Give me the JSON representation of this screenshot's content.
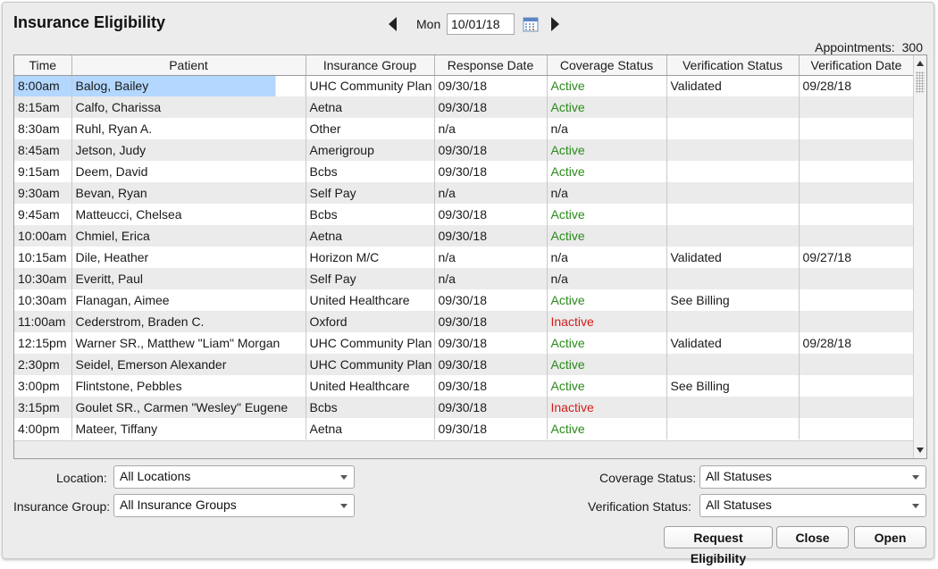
{
  "title": "Insurance Eligibility",
  "date_nav": {
    "day": "Mon",
    "date": "10/01/18"
  },
  "appointments": {
    "label": "Appointments:",
    "count": "300"
  },
  "columns": [
    "Time",
    "Patient",
    "Insurance Group",
    "Response Date",
    "Coverage Status",
    "Verification Status",
    "Verification Date"
  ],
  "rows": [
    {
      "time": "8:00am",
      "patient": "Balog, Bailey",
      "group": "UHC Community Plan",
      "response": "09/30/18",
      "coverage": "Active",
      "verification": "Validated",
      "vdate": "09/28/18"
    },
    {
      "time": "8:15am",
      "patient": "Calfo, Charissa",
      "group": "Aetna",
      "response": "09/30/18",
      "coverage": "Active",
      "verification": "",
      "vdate": ""
    },
    {
      "time": "8:30am",
      "patient": "Ruhl, Ryan A.",
      "group": "Other",
      "response": "n/a",
      "coverage": "n/a",
      "verification": "",
      "vdate": ""
    },
    {
      "time": "8:45am",
      "patient": "Jetson, Judy",
      "group": "Amerigroup",
      "response": "09/30/18",
      "coverage": "Active",
      "verification": "",
      "vdate": ""
    },
    {
      "time": "9:15am",
      "patient": "Deem, David",
      "group": "Bcbs",
      "response": "09/30/18",
      "coverage": "Active",
      "verification": "",
      "vdate": ""
    },
    {
      "time": "9:30am",
      "patient": "Bevan, Ryan",
      "group": "Self Pay",
      "response": "n/a",
      "coverage": "n/a",
      "verification": "",
      "vdate": ""
    },
    {
      "time": "9:45am",
      "patient": "Matteucci, Chelsea",
      "group": "Bcbs",
      "response": "09/30/18",
      "coverage": "Active",
      "verification": "",
      "vdate": ""
    },
    {
      "time": "10:00am",
      "patient": "Chmiel, Erica",
      "group": "Aetna",
      "response": "09/30/18",
      "coverage": "Active",
      "verification": "",
      "vdate": ""
    },
    {
      "time": "10:15am",
      "patient": "Dile, Heather",
      "group": "Horizon M/C",
      "response": "n/a",
      "coverage": "n/a",
      "verification": "Validated",
      "vdate": "09/27/18"
    },
    {
      "time": "10:30am",
      "patient": "Everitt, Paul",
      "group": "Self Pay",
      "response": "n/a",
      "coverage": "n/a",
      "verification": "",
      "vdate": ""
    },
    {
      "time": "10:30am",
      "patient": "Flanagan, Aimee",
      "group": "United Healthcare",
      "response": "09/30/18",
      "coverage": "Active",
      "verification": "See Billing",
      "vdate": ""
    },
    {
      "time": "11:00am",
      "patient": "Cederstrom, Braden C.",
      "group": "Oxford",
      "response": "09/30/18",
      "coverage": "Inactive",
      "verification": "",
      "vdate": ""
    },
    {
      "time": "12:15pm",
      "patient": "Warner SR., Matthew \"Liam\" Morgan",
      "group": "UHC Community Plan",
      "response": "09/30/18",
      "coverage": "Active",
      "verification": "Validated",
      "vdate": "09/28/18"
    },
    {
      "time": "2:30pm",
      "patient": "Seidel, Emerson Alexander",
      "group": "UHC Community Plan",
      "response": "09/30/18",
      "coverage": "Active",
      "verification": "",
      "vdate": ""
    },
    {
      "time": "3:00pm",
      "patient": "Flintstone, Pebbles",
      "group": "United Healthcare",
      "response": "09/30/18",
      "coverage": "Active",
      "verification": "See Billing",
      "vdate": ""
    },
    {
      "time": "3:15pm",
      "patient": "Goulet SR., Carmen \"Wesley\" Eugene",
      "group": "Bcbs",
      "response": "09/30/18",
      "coverage": "Inactive",
      "verification": "",
      "vdate": ""
    },
    {
      "time": "4:00pm",
      "patient": "Mateer, Tiffany",
      "group": "Aetna",
      "response": "09/30/18",
      "coverage": "Active",
      "verification": "",
      "vdate": ""
    }
  ],
  "selected_row": 0,
  "filters": {
    "location": {
      "label": "Location:",
      "value": "All Locations"
    },
    "insurance_group": {
      "label": "Insurance Group:",
      "value": "All Insurance Groups"
    },
    "coverage_status": {
      "label": "Coverage Status:",
      "value": "All Statuses"
    },
    "verification_status": {
      "label": "Verification Status:",
      "value": "All Statuses"
    }
  },
  "buttons": {
    "request": "Request Eligibility",
    "close": "Close",
    "open": "Open"
  },
  "colors": {
    "active": "#2a8a1a",
    "inactive": "#d41c1c",
    "selection": "#b3d7ff"
  },
  "icons": [
    "prev-day-icon",
    "calendar-icon",
    "next-day-icon",
    "scroll-up-icon",
    "scroll-down-icon",
    "dropdown-caret-icon"
  ]
}
